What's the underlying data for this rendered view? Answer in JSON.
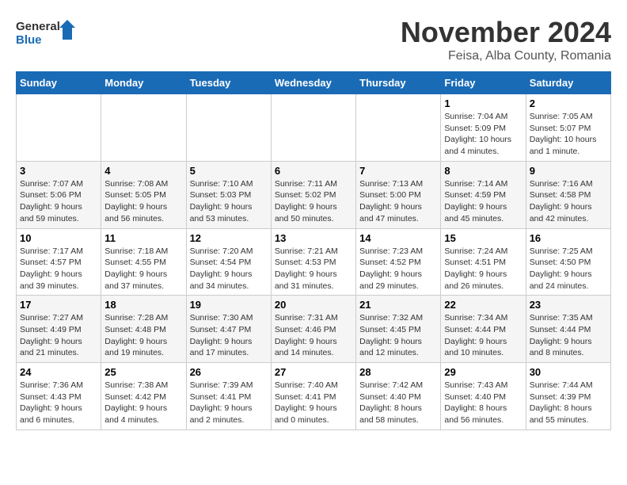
{
  "header": {
    "logo_line1": "General",
    "logo_line2": "Blue",
    "main_title": "November 2024",
    "subtitle": "Feisa, Alba County, Romania"
  },
  "calendar": {
    "days_of_week": [
      "Sunday",
      "Monday",
      "Tuesday",
      "Wednesday",
      "Thursday",
      "Friday",
      "Saturday"
    ],
    "weeks": [
      [
        {
          "day": "",
          "info": ""
        },
        {
          "day": "",
          "info": ""
        },
        {
          "day": "",
          "info": ""
        },
        {
          "day": "",
          "info": ""
        },
        {
          "day": "",
          "info": ""
        },
        {
          "day": "1",
          "info": "Sunrise: 7:04 AM\nSunset: 5:09 PM\nDaylight: 10 hours and 4 minutes."
        },
        {
          "day": "2",
          "info": "Sunrise: 7:05 AM\nSunset: 5:07 PM\nDaylight: 10 hours and 1 minute."
        }
      ],
      [
        {
          "day": "3",
          "info": "Sunrise: 7:07 AM\nSunset: 5:06 PM\nDaylight: 9 hours and 59 minutes."
        },
        {
          "day": "4",
          "info": "Sunrise: 7:08 AM\nSunset: 5:05 PM\nDaylight: 9 hours and 56 minutes."
        },
        {
          "day": "5",
          "info": "Sunrise: 7:10 AM\nSunset: 5:03 PM\nDaylight: 9 hours and 53 minutes."
        },
        {
          "day": "6",
          "info": "Sunrise: 7:11 AM\nSunset: 5:02 PM\nDaylight: 9 hours and 50 minutes."
        },
        {
          "day": "7",
          "info": "Sunrise: 7:13 AM\nSunset: 5:00 PM\nDaylight: 9 hours and 47 minutes."
        },
        {
          "day": "8",
          "info": "Sunrise: 7:14 AM\nSunset: 4:59 PM\nDaylight: 9 hours and 45 minutes."
        },
        {
          "day": "9",
          "info": "Sunrise: 7:16 AM\nSunset: 4:58 PM\nDaylight: 9 hours and 42 minutes."
        }
      ],
      [
        {
          "day": "10",
          "info": "Sunrise: 7:17 AM\nSunset: 4:57 PM\nDaylight: 9 hours and 39 minutes."
        },
        {
          "day": "11",
          "info": "Sunrise: 7:18 AM\nSunset: 4:55 PM\nDaylight: 9 hours and 37 minutes."
        },
        {
          "day": "12",
          "info": "Sunrise: 7:20 AM\nSunset: 4:54 PM\nDaylight: 9 hours and 34 minutes."
        },
        {
          "day": "13",
          "info": "Sunrise: 7:21 AM\nSunset: 4:53 PM\nDaylight: 9 hours and 31 minutes."
        },
        {
          "day": "14",
          "info": "Sunrise: 7:23 AM\nSunset: 4:52 PM\nDaylight: 9 hours and 29 minutes."
        },
        {
          "day": "15",
          "info": "Sunrise: 7:24 AM\nSunset: 4:51 PM\nDaylight: 9 hours and 26 minutes."
        },
        {
          "day": "16",
          "info": "Sunrise: 7:25 AM\nSunset: 4:50 PM\nDaylight: 9 hours and 24 minutes."
        }
      ],
      [
        {
          "day": "17",
          "info": "Sunrise: 7:27 AM\nSunset: 4:49 PM\nDaylight: 9 hours and 21 minutes."
        },
        {
          "day": "18",
          "info": "Sunrise: 7:28 AM\nSunset: 4:48 PM\nDaylight: 9 hours and 19 minutes."
        },
        {
          "day": "19",
          "info": "Sunrise: 7:30 AM\nSunset: 4:47 PM\nDaylight: 9 hours and 17 minutes."
        },
        {
          "day": "20",
          "info": "Sunrise: 7:31 AM\nSunset: 4:46 PM\nDaylight: 9 hours and 14 minutes."
        },
        {
          "day": "21",
          "info": "Sunrise: 7:32 AM\nSunset: 4:45 PM\nDaylight: 9 hours and 12 minutes."
        },
        {
          "day": "22",
          "info": "Sunrise: 7:34 AM\nSunset: 4:44 PM\nDaylight: 9 hours and 10 minutes."
        },
        {
          "day": "23",
          "info": "Sunrise: 7:35 AM\nSunset: 4:44 PM\nDaylight: 9 hours and 8 minutes."
        }
      ],
      [
        {
          "day": "24",
          "info": "Sunrise: 7:36 AM\nSunset: 4:43 PM\nDaylight: 9 hours and 6 minutes."
        },
        {
          "day": "25",
          "info": "Sunrise: 7:38 AM\nSunset: 4:42 PM\nDaylight: 9 hours and 4 minutes."
        },
        {
          "day": "26",
          "info": "Sunrise: 7:39 AM\nSunset: 4:41 PM\nDaylight: 9 hours and 2 minutes."
        },
        {
          "day": "27",
          "info": "Sunrise: 7:40 AM\nSunset: 4:41 PM\nDaylight: 9 hours and 0 minutes."
        },
        {
          "day": "28",
          "info": "Sunrise: 7:42 AM\nSunset: 4:40 PM\nDaylight: 8 hours and 58 minutes."
        },
        {
          "day": "29",
          "info": "Sunrise: 7:43 AM\nSunset: 4:40 PM\nDaylight: 8 hours and 56 minutes."
        },
        {
          "day": "30",
          "info": "Sunrise: 7:44 AM\nSunset: 4:39 PM\nDaylight: 8 hours and 55 minutes."
        }
      ]
    ]
  }
}
